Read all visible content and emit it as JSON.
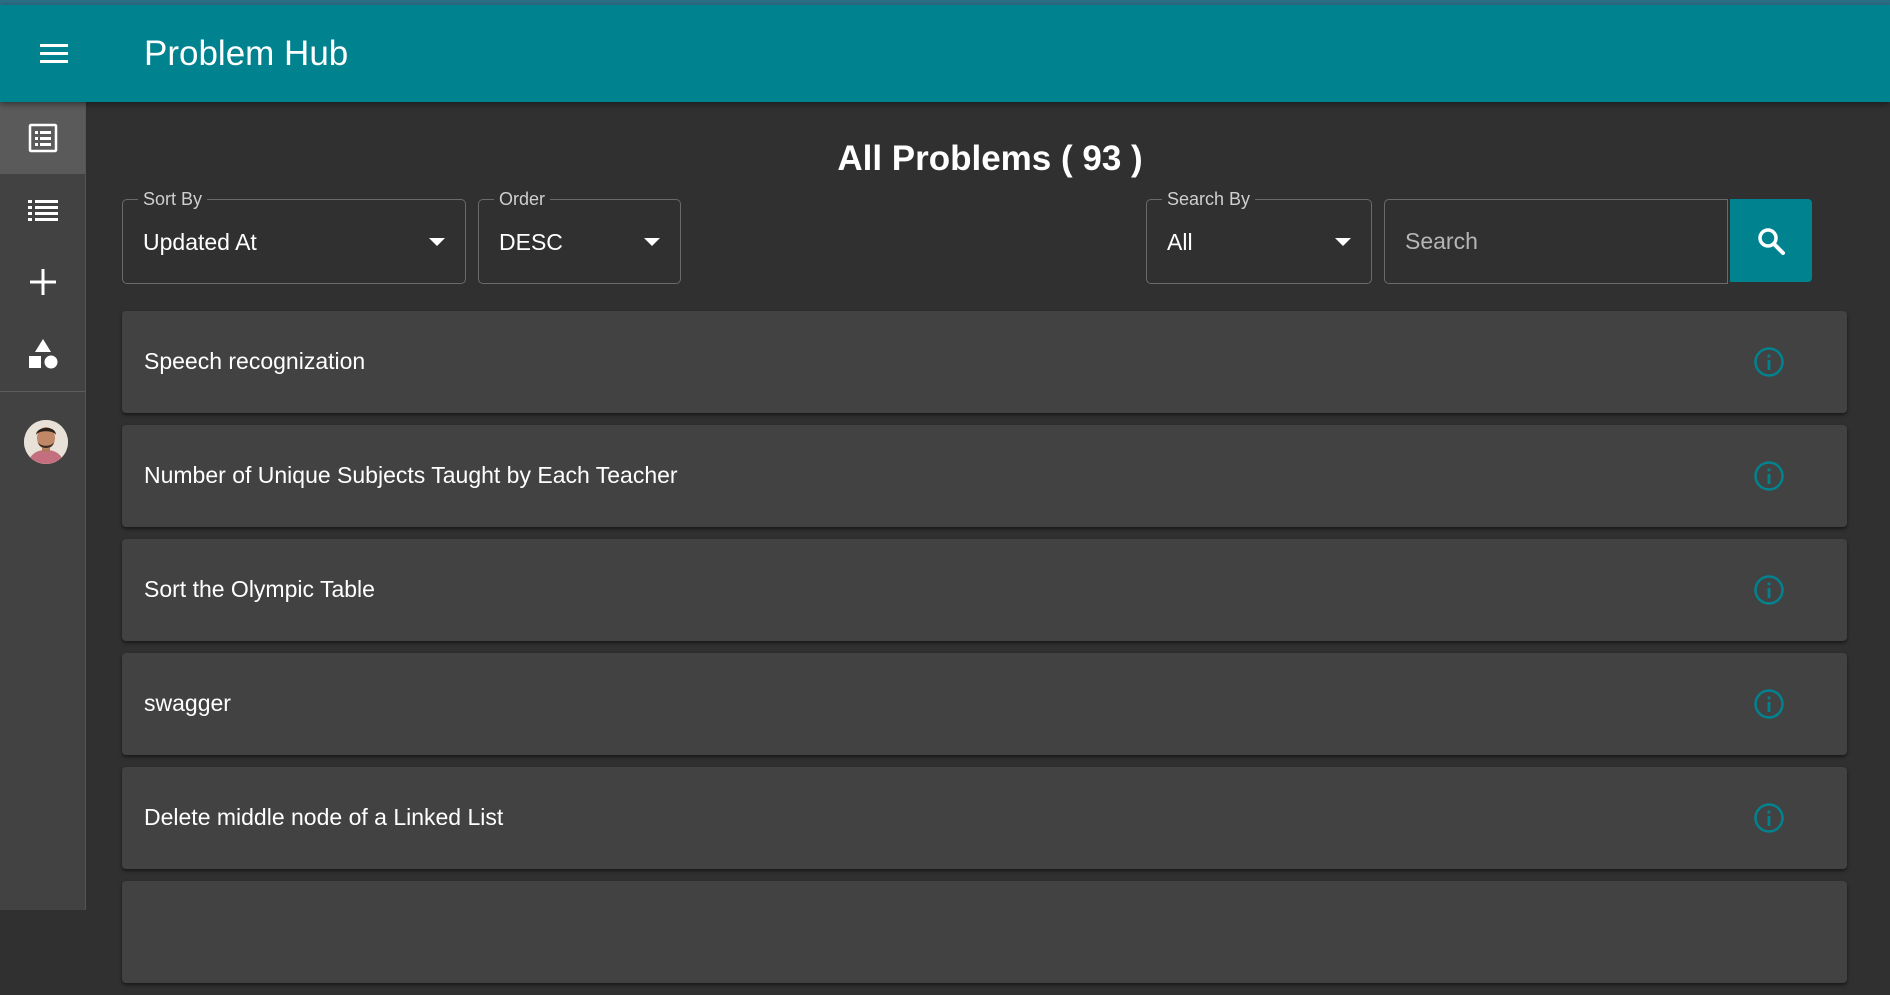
{
  "app": {
    "title": "Problem Hub"
  },
  "sidebar": {
    "items": [
      {
        "name": "problems-page-icon"
      },
      {
        "name": "list-icon"
      },
      {
        "name": "add-icon"
      },
      {
        "name": "category-icon"
      }
    ],
    "avatar": "user-avatar"
  },
  "page": {
    "title": "All Problems ( 93 )"
  },
  "filters": {
    "sort_by": {
      "label": "Sort By",
      "value": "Updated At"
    },
    "order": {
      "label": "Order",
      "value": "DESC"
    },
    "search_by": {
      "label": "Search By",
      "value": "All"
    },
    "search": {
      "placeholder": "Search",
      "value": ""
    }
  },
  "problems": [
    {
      "title": "Speech recognization"
    },
    {
      "title": "Number of Unique Subjects Taught by Each Teacher"
    },
    {
      "title": "Sort the Olympic Table"
    },
    {
      "title": "swagger"
    },
    {
      "title": "Delete middle node of a Linked List"
    },
    {
      "title": ""
    }
  ],
  "colors": {
    "primary": "#00838f",
    "background": "#303030",
    "surface": "#424242",
    "icon_accent": "#00838f"
  }
}
